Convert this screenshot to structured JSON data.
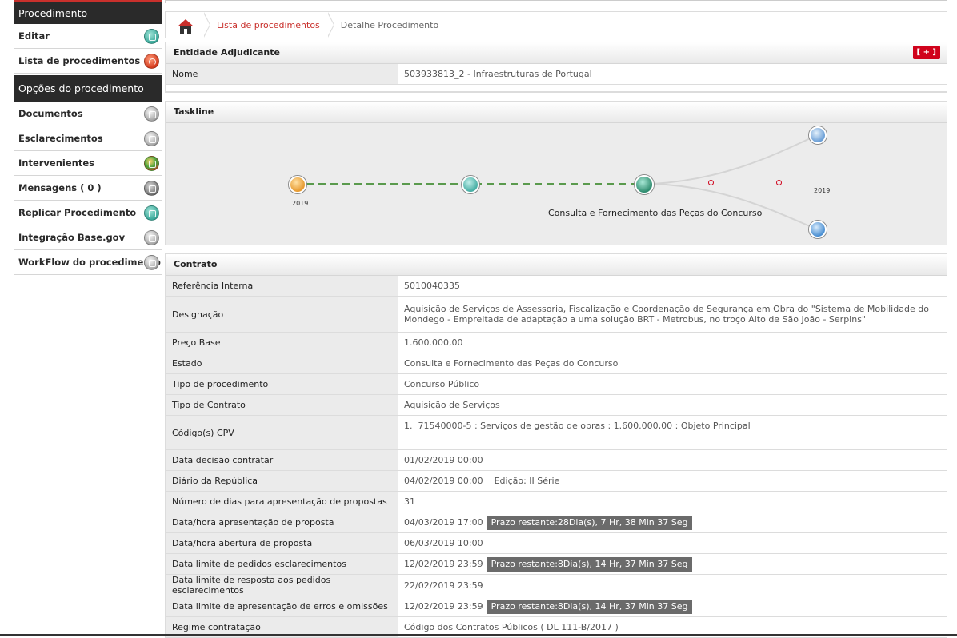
{
  "sidebar": {
    "header1": "Procedimento",
    "items1": [
      {
        "label": "Editar",
        "icon": "edit-icon"
      },
      {
        "label": "Lista de procedimentos",
        "icon": "back-icon"
      }
    ],
    "header2": "Opções do procedimento",
    "items2": [
      {
        "label": "Documentos",
        "icon": "documents-icon"
      },
      {
        "label": "Esclarecimentos",
        "icon": "info-icon"
      },
      {
        "label": "Intervenientes",
        "icon": "people-icon"
      },
      {
        "label": "Mensagens ( 0 )",
        "icon": "messages-icon"
      },
      {
        "label": "Replicar Procedimento",
        "icon": "replicate-icon"
      },
      {
        "label": "Integração Base.gov",
        "icon": "megaphone-icon"
      },
      {
        "label": "WorkFlow do procedimento",
        "icon": "workflow-icon"
      }
    ]
  },
  "breadcrumb": {
    "link": "Lista de procedimentos",
    "current": "Detalhe Procedimento"
  },
  "entidade": {
    "title": "Entidade Adjudicante",
    "plus": "[ + ]",
    "nome_label": "Nome",
    "nome_value": "503933813_2 - Infraestruturas de Portugal"
  },
  "taskline": {
    "title": "Taskline",
    "year_left": "2019",
    "year_right": "2019",
    "caption": "Consulta e Fornecimento das Peças do Concurso"
  },
  "contrato": {
    "title": "Contrato",
    "rows": [
      {
        "k": "Referência Interna",
        "v": "5010040335"
      },
      {
        "k": "Designação",
        "v": "Aquisição de Serviços de Assessoria, Fiscalização e Coordenação de Segurança em Obra do \"Sistema de Mobilidade do Mondego - Empreitada de adaptação a uma solução BRT - Metrobus, no troço Alto de São João - Serpins\""
      },
      {
        "k": "Preço Base",
        "v": "1.600.000,00"
      },
      {
        "k": "Estado",
        "v": "Consulta e Fornecimento das Peças do Concurso"
      },
      {
        "k": "Tipo de procedimento",
        "v": "Concurso Público"
      },
      {
        "k": "Tipo de Contrato",
        "v": "Aquisição de Serviços"
      },
      {
        "k": "Código(s) CPV",
        "v": "1.  71540000-5 : Serviços de gestão de obras : 1.600.000,00 : Objeto Principal"
      },
      {
        "k": "Data decisão contratar",
        "v": "01/02/2019 00:00"
      },
      {
        "k": "Diário da República",
        "v": "04/02/2019 00:00    Edição: II Série"
      },
      {
        "k": "Número de dias para apresentação de propostas",
        "v": "31"
      },
      {
        "k": "Data/hora apresentação de proposta",
        "v": "04/03/2019 17:00",
        "badge": "Prazo restante:28Dia(s), 7 Hr, 38 Min 37 Seg"
      },
      {
        "k": "Data/hora abertura de proposta",
        "v": "06/03/2019 10:00"
      },
      {
        "k": "Data limite de pedidos esclarecimentos",
        "v": "12/02/2019 23:59",
        "badge": "Prazo restante:8Dia(s), 14 Hr, 37 Min 37 Seg"
      },
      {
        "k": "Data limite de resposta aos pedidos esclarecimentos",
        "v": "22/02/2019 23:59"
      },
      {
        "k": "Data limite de apresentação de erros e omissões",
        "v": "12/02/2019 23:59",
        "badge": "Prazo restante:8Dia(s), 14 Hr, 37 Min 37 Seg"
      },
      {
        "k": "Regime contratação",
        "v": "Código dos Contratos Públicos ( DL 111-B/2017 )"
      }
    ]
  }
}
